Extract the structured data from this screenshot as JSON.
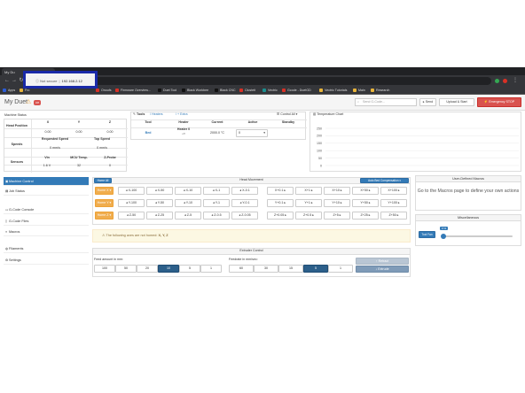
{
  "browser": {
    "tab_title": "My Du",
    "security": "Not secure",
    "url": "192.168.2.12",
    "bookmarks": [
      "Apps",
      "Fro",
      "Onoufs",
      "Firmware Overview...",
      "Duet Tool",
      "Black Workbee",
      "Black CNC",
      "Clusteit",
      "Vectric",
      "Gcode - DuetGD",
      "Vectric Tutorials",
      "Main",
      "Research"
    ]
  },
  "header": {
    "title": "My Duet",
    "status_badge": "Off",
    "gcode_placeholder": "Send G-Code...",
    "send_label": "Send",
    "upload_label": "Upload & Start",
    "estop_label": "Emergency STOP"
  },
  "machine_status": {
    "title": "Machine Status",
    "head_position_label": "Head Position",
    "axes": [
      "X",
      "Y",
      "Z"
    ],
    "positions": [
      "0.00",
      "0.00",
      "0.00"
    ],
    "speeds_label": "Speeds",
    "requested_speed_label": "Requested Speed",
    "top_speed_label": "Top Speed",
    "requested_speed": "0 mm/s",
    "top_speed": "0 mm/s",
    "sensors_label": "Sensors",
    "vin_label": "Vin",
    "mcu_temp_label": "MCU Temp.",
    "zprobe_label": "Z-Probe",
    "vin": "1.6 V",
    "mcu_temp": "32",
    "zprobe": "0"
  },
  "tools": {
    "tools_label": "Tools",
    "heaters_label": "Heaters",
    "extra_label": "Extra",
    "control_all_label": "Control All",
    "columns": [
      "Tool",
      "Heater",
      "Current",
      "Active",
      "Standby"
    ],
    "row_tool": "Bed",
    "row_heater": "Heater 0",
    "row_heater_state": "off",
    "row_current": "2000.0 °C",
    "row_active": "0"
  },
  "temp_chart": {
    "title": "Temperature Chart",
    "ticks": [
      "250",
      "200",
      "150",
      "100",
      "50",
      "0"
    ]
  },
  "sidebar": {
    "items": [
      "Machine Control",
      "Job Status",
      "G-Code Console",
      "G-Code Files",
      "Macros",
      "Filaments",
      "Settings"
    ]
  },
  "head_movement": {
    "title": "Head Movement",
    "home_all_label": "Home All",
    "auto_bed_label": "Auto Bed Compensation",
    "home_labels": [
      "Home X",
      "Home Y",
      "Home Z"
    ],
    "rows": [
      {
        "minus": [
          "X-100",
          "X-50",
          "X-10",
          "X-1",
          "X-0.1"
        ],
        "plus": [
          "X+0.1",
          "X+1",
          "X+10",
          "X+50",
          "X+100"
        ]
      },
      {
        "minus": [
          "Y-100",
          "Y-50",
          "Y-10",
          "Y-1",
          "Y-0.1"
        ],
        "plus": [
          "Y+0.1",
          "Y+1",
          "Y+10",
          "Y+50",
          "Y+100"
        ]
      },
      {
        "minus": [
          "Z-50",
          "Z-25",
          "Z-5",
          "Z-0.5",
          "Z-0.05"
        ],
        "plus": [
          "Z+0.05",
          "Z+0.5",
          "Z+5",
          "Z+25",
          "Z+50"
        ]
      }
    ]
  },
  "alert": {
    "text": "The following axes are not homed:",
    "axes": "X, Y, Z"
  },
  "extruder": {
    "title": "Extruder Control",
    "feed_label": "Feed amount in mm:",
    "feed_amounts": [
      "100",
      "50",
      "20",
      "10",
      "5",
      "1"
    ],
    "feed_selected": "10",
    "feedrate_label": "Feedrate in mm/sec:",
    "feedrates": [
      "60",
      "30",
      "15",
      "5",
      "1"
    ],
    "feedrate_selected": "5",
    "retract_label": "Retract",
    "extrude_label": "Extrude"
  },
  "macros_panel": {
    "title": "User-Defined Macros",
    "text": "Go to the Macros page to define your own actions"
  },
  "misc": {
    "title": "Miscellaneous",
    "tool_fan_label": "Tool Fan",
    "fan_value": "0 %",
    "fan_level": 0
  },
  "colors": {
    "primary": "#337ab7",
    "danger": "#d9534f",
    "warning": "#f0ad4e",
    "selected": "#2c5f8a",
    "highlight": "#1a2aa8"
  }
}
